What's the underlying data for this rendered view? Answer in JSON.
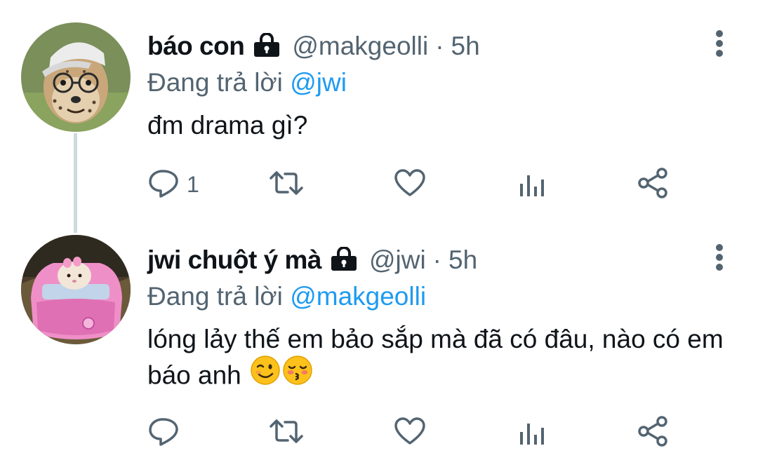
{
  "thread": [
    {
      "display_name": "báo con",
      "handle": "@makgeolli",
      "separator": "·",
      "time": "5h",
      "reply_prefix": "Đang trả lời",
      "reply_to": "@jwi",
      "text": "đm drama gì?",
      "reply_count": "1",
      "avatar": "cheetah-cub-with-glasses-and-cap",
      "colors": {
        "avatar_bg": "#7a8f5a"
      }
    },
    {
      "display_name": "jwi chuột ý mà",
      "handle": "@jwi",
      "separator": "·",
      "time": "5h",
      "reply_prefix": "Đang trả lời",
      "reply_to": "@makgeolli",
      "text": "lóng lảy thế em bảo sắp mà đã có đâu, nào có em báo anh",
      "emojis": [
        "winking-face",
        "kissing-face-with-closed-eyes"
      ],
      "reply_count": "",
      "avatar": "hamster-in-pink-toy-car",
      "colors": {
        "avatar_bg": "#4a3b2a"
      }
    }
  ],
  "colors": {
    "text": "#0f1419",
    "secondary": "#536471",
    "accent": "#1d9bf0",
    "thread_line": "#cfd9de"
  },
  "icons": [
    "lock-icon",
    "more-vertical-icon",
    "reply-icon",
    "retweet-icon",
    "like-icon",
    "views-icon",
    "share-icon"
  ]
}
